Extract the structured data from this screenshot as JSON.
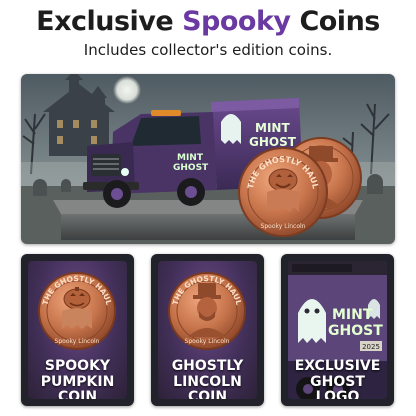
{
  "header": {
    "title_part1": "Exclusive ",
    "title_accent": "Spooky",
    "title_part2": " Coins",
    "subtitle": "Includes collector's edition coins."
  },
  "hero": {
    "truck_text_line1": "MINT",
    "truck_text_line2": "GHOST",
    "coin_ring_text": "THE GHOSTLY HAUL",
    "coin_bottom_text": "Spooky Lincoln"
  },
  "cards": [
    {
      "line1": "SPOOKY",
      "line2": "PUMPKIN COIN",
      "coin_ring": "THE GHOSTLY HAUL",
      "coin_bottom": "Spooky Lincoln"
    },
    {
      "line1": "GHOSTLY",
      "line2": "LINCOLN COIN",
      "coin_ring": "THE GHOSTLY HAUL",
      "coin_bottom": "Spooky Lincoln"
    },
    {
      "line1": "EXCLUSIVE",
      "line2": "GHOST LOGO",
      "truck_text_line1": "MINT",
      "truck_text_line2": "GHOST",
      "truck_number": "2025"
    }
  ],
  "colors": {
    "accent_purple": "#6a3aa2",
    "copper": "#c0714a",
    "dark_text": "#1d1d1d"
  }
}
